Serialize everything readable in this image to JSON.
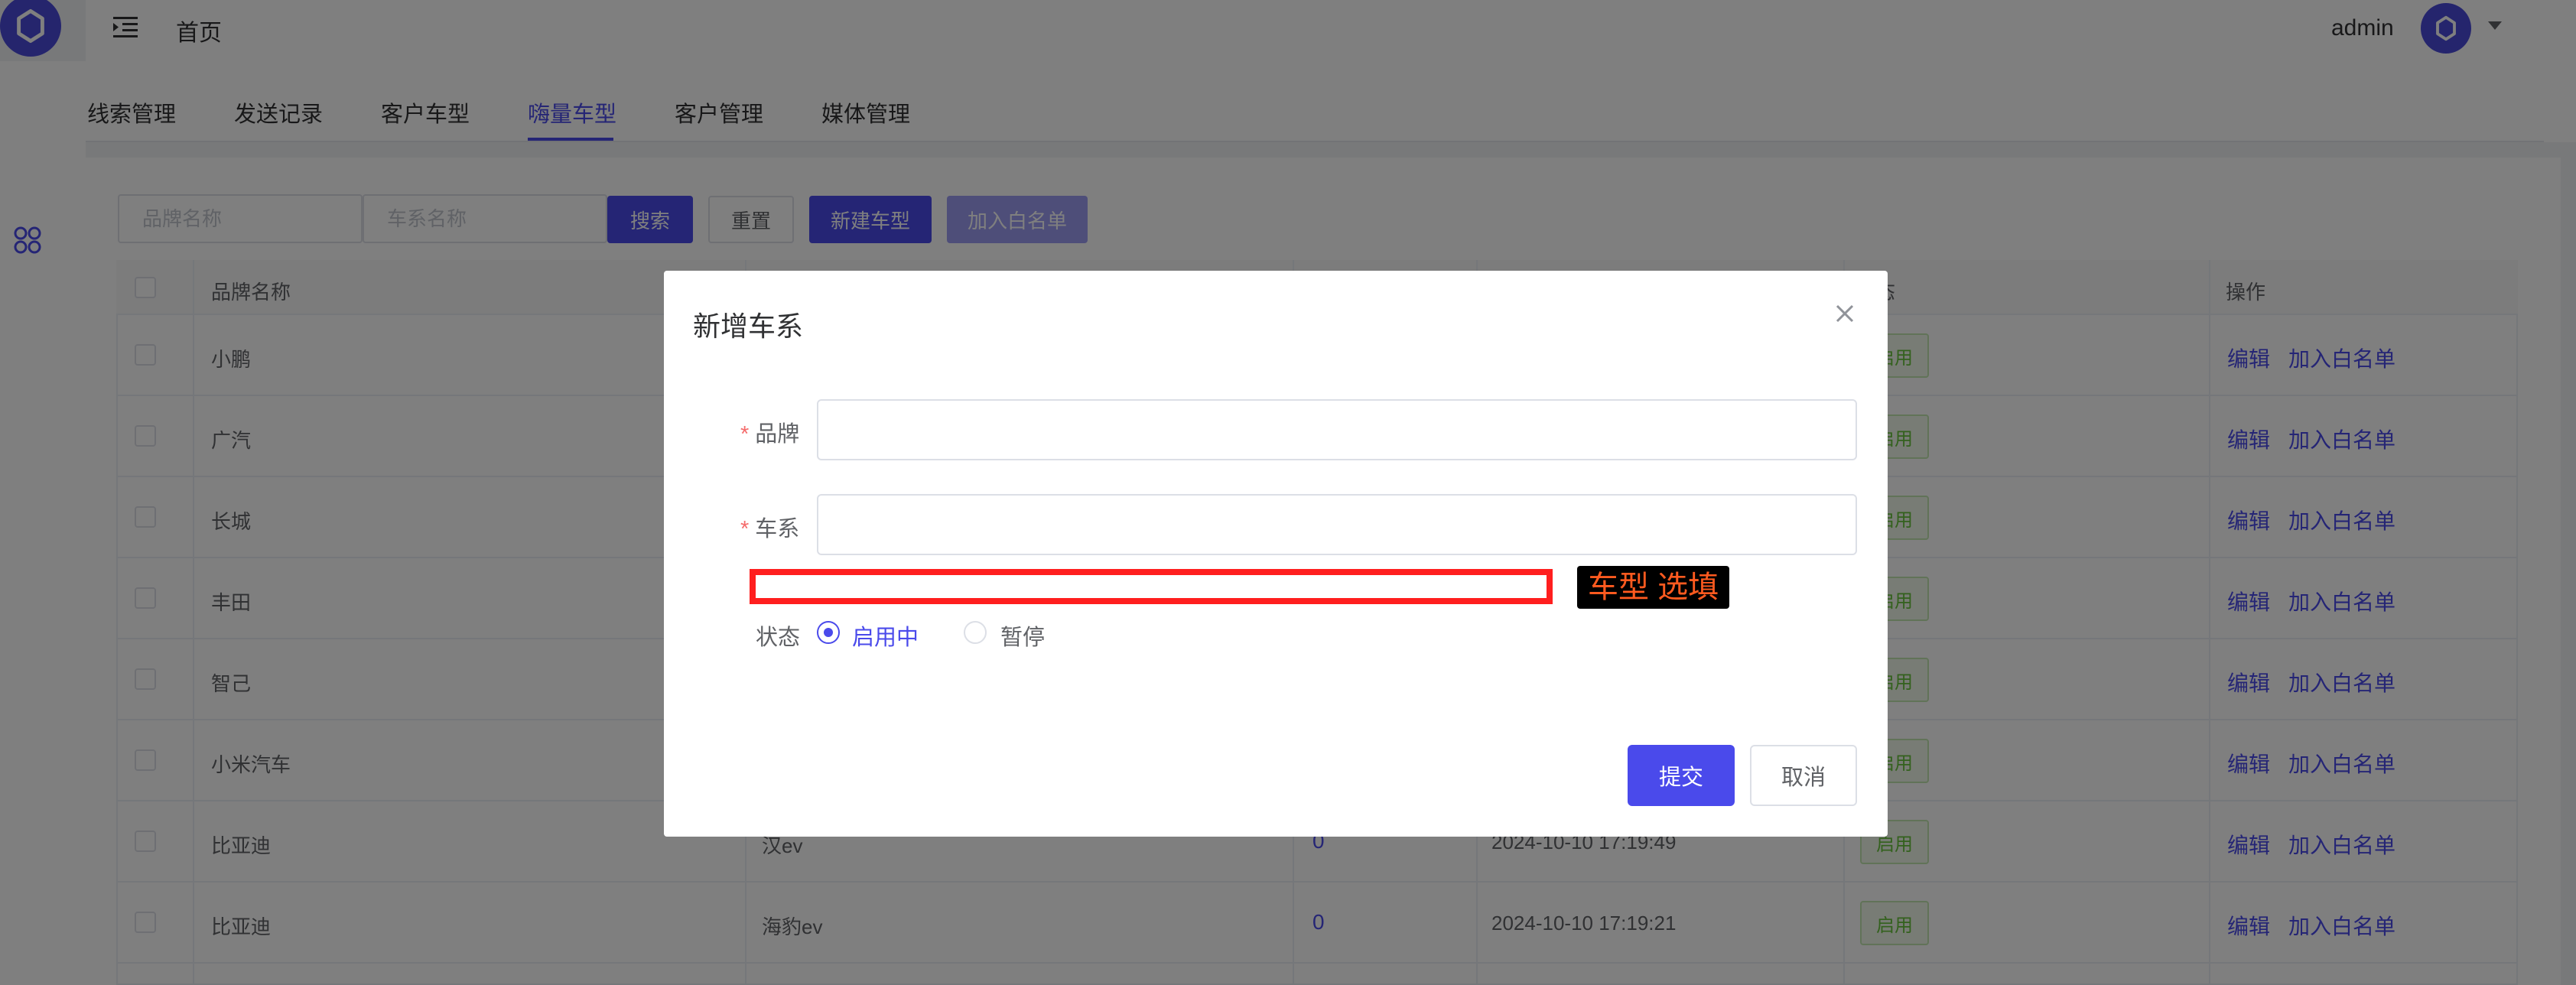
{
  "header": {
    "home": "首页",
    "username": "admin"
  },
  "tabs": [
    {
      "label": "线索管理"
    },
    {
      "label": "发送记录"
    },
    {
      "label": "客户车型"
    },
    {
      "label": "嗨量车型"
    },
    {
      "label": "客户管理"
    },
    {
      "label": "媒体管理"
    }
  ],
  "active_tab": "嗨量车型",
  "search": {
    "brand_placeholder": "品牌名称",
    "series_placeholder": "车系名称",
    "search_label": "搜索",
    "reset_label": "重置",
    "new_label": "新建车型",
    "whitelist_label": "加入白名单"
  },
  "table": {
    "headers": {
      "brand": "品牌名称",
      "status_partial": "态",
      "actions": "操作"
    },
    "rows": [
      {
        "brand": "小鹏",
        "series": "",
        "count": "",
        "time": "",
        "status": "启用"
      },
      {
        "brand": "广汽",
        "series": "",
        "count": "",
        "time": "",
        "status": "启用"
      },
      {
        "brand": "长城",
        "series": "",
        "count": "",
        "time": "",
        "status": "启用"
      },
      {
        "brand": "丰田",
        "series": "",
        "count": "",
        "time": "",
        "status": "启用"
      },
      {
        "brand": "智己",
        "series": "",
        "count": "",
        "time": "",
        "status": "启用"
      },
      {
        "brand": "小米汽车",
        "series": "",
        "count": "",
        "time": "",
        "status": "启用"
      },
      {
        "brand": "比亚迪",
        "series": "汉ev",
        "count": "0",
        "time": "2024-10-10 17:19:49",
        "status": "启用"
      },
      {
        "brand": "比亚迪",
        "series": "海豹ev",
        "count": "0",
        "time": "2024-10-10 17:19:21",
        "status": "启用"
      }
    ],
    "edit_label": "编辑",
    "whitelist_label": "加入白名单"
  },
  "dialog": {
    "title": "新增车系",
    "brand_label": "品牌",
    "series_label": "车系",
    "required_mark": "*",
    "annotation": "车型 选填",
    "status_label": "状态",
    "status_options": [
      "启用中",
      "暂停"
    ],
    "status_selected": "启用中",
    "submit_label": "提交",
    "cancel_label": "取消"
  },
  "colors": {
    "primary": "#4a4aeb",
    "highlight": "#ff1f1f",
    "annotation_text": "#ff5a1f",
    "success": "#67c23a"
  }
}
